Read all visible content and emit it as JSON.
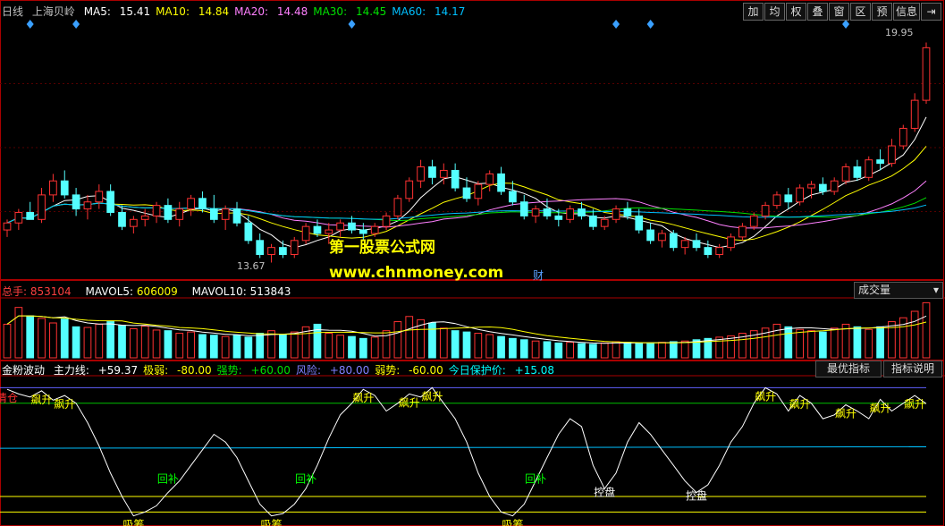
{
  "price_header": {
    "period": "日线",
    "stock_name": "上海贝岭",
    "ma": [
      {
        "label": "MA5: ",
        "value": "15.41",
        "color": "#ffffff"
      },
      {
        "label": "MA10: ",
        "value": "14.84",
        "color": "#ffff00"
      },
      {
        "label": "MA20: ",
        "value": "14.48",
        "color": "#ff80ff"
      },
      {
        "label": "MA30: ",
        "value": "14.45",
        "color": "#00e000"
      },
      {
        "label": "MA60: ",
        "value": "14.17",
        "color": "#00c0ff"
      }
    ]
  },
  "toolbar": [
    "加",
    "均",
    "权",
    "叠",
    "窗",
    "区",
    "预",
    "信息",
    "⇥"
  ],
  "price_labels": {
    "high": "19.95",
    "low": "13.67"
  },
  "watermark": {
    "line1": "第一股票公式网",
    "line2": "www.chnmoney.com",
    "note": "财"
  },
  "volume_header": {
    "title": "总手: ",
    "total": "853104",
    "mavol5_label": "MAVOL5: ",
    "mavol5": "606009",
    "mavol10_label": "MAVOL10: ",
    "mavol10": "513843",
    "dropdown": "成交量"
  },
  "indicator_header": {
    "name": "金粉波动",
    "items": [
      {
        "label": "主力线: ",
        "value": "+59.37",
        "color": "#ffffff"
      },
      {
        "label": "极弱: ",
        "value": "-80.00",
        "color": "#ffff00"
      },
      {
        "label": "强势: ",
        "value": "+60.00",
        "color": "#00e000"
      },
      {
        "label": "风险: ",
        "value": "+80.00",
        "color": "#8080ff"
      },
      {
        "label": "弱势: ",
        "value": "-60.00",
        "color": "#ffff00"
      },
      {
        "label": "今日保护价: ",
        "value": "+15.08",
        "color": "#00ffff"
      }
    ],
    "btn_best": "最优指标",
    "btn_help": "指标说明"
  },
  "signal_labels": {
    "rise": "飙升",
    "control": "控盘",
    "rebound": "回补",
    "absorb": "吸筹",
    "clear": "清仓"
  },
  "chart_data": [
    {
      "type": "candlestick",
      "title": "上海贝岭 日线",
      "high_label": 19.95,
      "low_label": 13.67,
      "ylim": [
        13.3,
        20.6
      ],
      "ma_last": {
        "MA5": 15.41,
        "MA10": 14.84,
        "MA20": 14.48,
        "MA30": 14.45,
        "MA60": 14.17
      },
      "candles": [
        [
          14.6,
          14.9,
          14.4,
          14.8
        ],
        [
          14.8,
          15.2,
          14.6,
          15.1
        ],
        [
          15.1,
          15.4,
          14.9,
          14.9
        ],
        [
          14.9,
          15.8,
          14.8,
          15.6
        ],
        [
          15.6,
          16.2,
          15.4,
          16.0
        ],
        [
          16.0,
          16.3,
          15.5,
          15.6
        ],
        [
          15.6,
          15.8,
          15.0,
          15.2
        ],
        [
          15.2,
          15.6,
          14.9,
          15.4
        ],
        [
          15.4,
          15.9,
          15.2,
          15.7
        ],
        [
          15.7,
          15.9,
          15.0,
          15.1
        ],
        [
          15.1,
          15.3,
          14.6,
          14.7
        ],
        [
          14.7,
          15.0,
          14.5,
          14.9
        ],
        [
          14.9,
          15.2,
          14.7,
          15.0
        ],
        [
          15.0,
          15.4,
          14.8,
          15.3
        ],
        [
          15.3,
          15.5,
          14.8,
          14.9
        ],
        [
          14.9,
          15.4,
          14.7,
          15.2
        ],
        [
          15.2,
          15.6,
          15.0,
          15.5
        ],
        [
          15.5,
          15.7,
          15.1,
          15.2
        ],
        [
          15.2,
          15.6,
          14.8,
          14.9
        ],
        [
          14.9,
          15.3,
          14.6,
          15.2
        ],
        [
          15.2,
          15.4,
          14.7,
          14.8
        ],
        [
          14.8,
          15.0,
          14.2,
          14.3
        ],
        [
          14.3,
          14.5,
          13.8,
          13.9
        ],
        [
          13.9,
          14.2,
          13.67,
          14.1
        ],
        [
          14.1,
          14.3,
          13.8,
          13.9
        ],
        [
          13.9,
          14.4,
          13.8,
          14.3
        ],
        [
          14.3,
          14.8,
          14.2,
          14.7
        ],
        [
          14.7,
          14.9,
          14.4,
          14.5
        ],
        [
          14.5,
          14.8,
          14.2,
          14.6
        ],
        [
          14.6,
          14.9,
          14.4,
          14.8
        ],
        [
          14.8,
          15.0,
          14.5,
          14.6
        ],
        [
          14.6,
          14.8,
          14.3,
          14.5
        ],
        [
          14.5,
          14.8,
          14.4,
          14.7
        ],
        [
          14.7,
          15.1,
          14.6,
          15.0
        ],
        [
          15.0,
          15.6,
          14.9,
          15.5
        ],
        [
          15.5,
          16.1,
          15.4,
          16.0
        ],
        [
          16.0,
          16.6,
          15.8,
          16.4
        ],
        [
          16.4,
          16.6,
          15.9,
          16.1
        ],
        [
          16.1,
          16.5,
          15.9,
          16.3
        ],
        [
          16.3,
          16.5,
          15.7,
          15.8
        ],
        [
          15.8,
          16.1,
          15.4,
          15.5
        ],
        [
          15.5,
          16.0,
          15.3,
          15.9
        ],
        [
          15.9,
          16.3,
          15.7,
          16.2
        ],
        [
          16.2,
          16.4,
          15.6,
          15.7
        ],
        [
          15.7,
          16.0,
          15.3,
          15.4
        ],
        [
          15.4,
          15.6,
          14.9,
          15.0
        ],
        [
          15.0,
          15.3,
          14.8,
          15.2
        ],
        [
          15.2,
          15.5,
          14.9,
          15.0
        ],
        [
          15.0,
          15.2,
          14.7,
          14.9
        ],
        [
          14.9,
          15.3,
          14.8,
          15.2
        ],
        [
          15.2,
          15.4,
          14.9,
          15.0
        ],
        [
          15.0,
          15.2,
          14.6,
          14.7
        ],
        [
          14.7,
          15.0,
          14.6,
          14.9
        ],
        [
          14.9,
          15.3,
          14.8,
          15.2
        ],
        [
          15.2,
          15.4,
          14.9,
          15.0
        ],
        [
          15.0,
          15.2,
          14.5,
          14.6
        ],
        [
          14.6,
          14.8,
          14.2,
          14.3
        ],
        [
          14.3,
          14.6,
          14.1,
          14.5
        ],
        [
          14.5,
          14.6,
          14.0,
          14.1
        ],
        [
          14.1,
          14.4,
          13.9,
          14.3
        ],
        [
          14.3,
          14.5,
          14.0,
          14.1
        ],
        [
          14.1,
          14.3,
          13.8,
          13.9
        ],
        [
          13.9,
          14.2,
          13.8,
          14.1
        ],
        [
          14.1,
          14.5,
          14.0,
          14.4
        ],
        [
          14.4,
          14.8,
          14.3,
          14.7
        ],
        [
          14.7,
          15.1,
          14.6,
          15.0
        ],
        [
          15.0,
          15.4,
          14.9,
          15.3
        ],
        [
          15.3,
          15.7,
          15.2,
          15.6
        ],
        [
          15.6,
          15.8,
          15.2,
          15.4
        ],
        [
          15.4,
          15.9,
          15.3,
          15.8
        ],
        [
          15.8,
          16.0,
          15.5,
          15.9
        ],
        [
          15.9,
          16.1,
          15.6,
          15.7
        ],
        [
          15.7,
          16.1,
          15.6,
          16.0
        ],
        [
          16.0,
          16.5,
          15.9,
          16.4
        ],
        [
          16.4,
          16.6,
          16.0,
          16.1
        ],
        [
          16.1,
          16.7,
          16.0,
          16.6
        ],
        [
          16.6,
          16.9,
          16.3,
          16.5
        ],
        [
          16.5,
          17.2,
          16.4,
          17.0
        ],
        [
          17.0,
          17.6,
          16.9,
          17.5
        ],
        [
          17.5,
          18.5,
          17.4,
          18.3
        ],
        [
          18.3,
          19.95,
          18.2,
          19.8
        ]
      ]
    },
    {
      "type": "bar",
      "title": "成交量",
      "series": [
        {
          "name": "MAVOL5",
          "last": 606009
        },
        {
          "name": "MAVOL10",
          "last": 513843
        }
      ],
      "total_last": 853104,
      "values": [
        520000,
        780000,
        650000,
        610000,
        540000,
        600000,
        480000,
        470000,
        520000,
        560000,
        500000,
        450000,
        490000,
        430000,
        420000,
        380000,
        400000,
        360000,
        350000,
        330000,
        350000,
        320000,
        380000,
        420000,
        360000,
        400000,
        480000,
        520000,
        380000,
        350000,
        330000,
        300000,
        320000,
        420000,
        560000,
        640000,
        590000,
        540000,
        460000,
        420000,
        400000,
        380000,
        360000,
        330000,
        300000,
        280000,
        260000,
        250000,
        230000,
        240000,
        220000,
        210000,
        230000,
        250000,
        240000,
        230000,
        220000,
        240000,
        250000,
        260000,
        280000,
        300000,
        320000,
        340000,
        380000,
        420000,
        460000,
        520000,
        480000,
        440000,
        420000,
        400000,
        460000,
        520000,
        480000,
        440000,
        480000,
        560000,
        620000,
        720000,
        853104
      ]
    },
    {
      "type": "line",
      "title": "金粉波动",
      "series": [
        {
          "name": "主力线",
          "last": 59.37
        }
      ],
      "levels": {
        "风险": 80,
        "强势": 60,
        "弱势": -60,
        "极弱": -80
      },
      "ylim": [
        -90,
        92
      ],
      "values": [
        78,
        72,
        68,
        76,
        64,
        70,
        60,
        35,
        5,
        -30,
        -60,
        -85,
        -80,
        -72,
        -55,
        -40,
        -20,
        0,
        20,
        10,
        -10,
        -40,
        -70,
        -85,
        -82,
        -70,
        -50,
        -20,
        15,
        45,
        60,
        78,
        70,
        50,
        60,
        72,
        68,
        80,
        60,
        40,
        10,
        -30,
        -60,
        -80,
        -85,
        -70,
        -40,
        -10,
        20,
        40,
        30,
        -20,
        -50,
        -30,
        10,
        35,
        20,
        0,
        -20,
        -40,
        -55,
        -45,
        -20,
        10,
        30,
        60,
        80,
        72,
        50,
        70,
        60,
        40,
        45,
        58,
        50,
        40,
        65,
        50,
        60,
        70,
        59.37
      ]
    }
  ]
}
